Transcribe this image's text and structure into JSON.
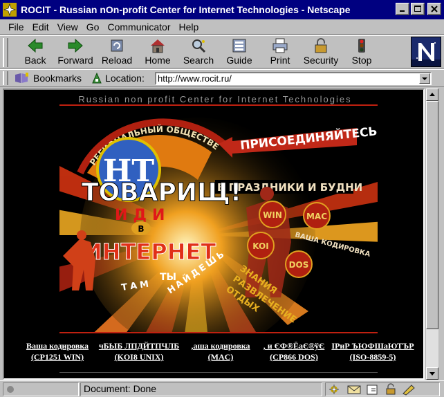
{
  "window": {
    "title": "ROCIT - Russian nOn-profit Center for Internet Technologies - Netscape"
  },
  "menu": [
    "File",
    "Edit",
    "View",
    "Go",
    "Communicator",
    "Help"
  ],
  "toolbar": {
    "back": "Back",
    "forward": "Forward",
    "reload": "Reload",
    "home": "Home",
    "search": "Search",
    "guide": "Guide",
    "print": "Print",
    "security": "Security",
    "stop": "Stop"
  },
  "location_bar": {
    "bookmarks": "Bookmarks",
    "location_label": "Location:",
    "url": "http://www.rocit.ru/"
  },
  "page": {
    "tagline": "Russian non profit Center for Internet Technologies",
    "poster": {
      "logo_text": "НТ",
      "arc_text": "РЕГИОНАЛЬНЫЙ ОБЩЕСТВЕННЫЙ ЦЕНТР ИНТЕРНЕТ ТЕХНОЛОГИЙ",
      "join": "ПРИСОЕДИНЯЙТЕСЬ!",
      "holidays": "В ПРАЗДНИКИ И БУДНИ",
      "comrade": "ТОВАРИЩ!",
      "go": "ИДИ",
      "in": "В",
      "internet": "ИНТЕРНЕТ",
      "you": "ТЫ",
      "there": "ТАМ",
      "find": "НАЙДЕШЬ",
      "knowledge": "ЗНАНИЯ",
      "entertainment": "РАЗВЛЕЧЕНИЕ",
      "rest": "ОТДЫХ",
      "your_encoding": "ВАША КОДИРОВКА",
      "badges": [
        "WIN",
        "MAC",
        "KOI",
        "DOS"
      ]
    },
    "encodings": [
      {
        "line1": "Ваша кодировка",
        "line2": "(CP1251 WIN)"
      },
      {
        "line1": "чБЫБ ЛПДЙТПЧЛБ",
        "line2": "(KOI8 UNIX)"
      },
      {
        "line1": ",аша кодировка",
        "line2": "(MAC)"
      },
      {
        "line1": ", и  ЄФ®ЁаЄ®ўЄ",
        "line2": "(CP866 DOS)"
      },
      {
        "line1": "ІРиР ЪЮФШаЮТЪР",
        "line2": "(ISO-8859-5)"
      }
    ]
  },
  "status": {
    "text": "Document: Done"
  },
  "colors": {
    "titlebar": "#000080",
    "chrome": "#c0c0c0",
    "poster_red": "#d02a1a",
    "poster_orange": "#e88a1a"
  }
}
